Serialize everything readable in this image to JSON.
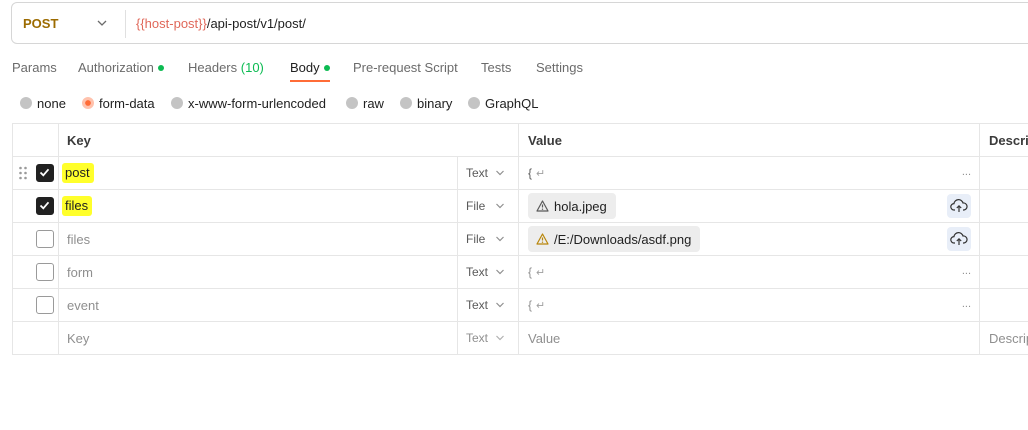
{
  "request": {
    "method": "POST",
    "url_variable": "{{host-post}}",
    "url_path": "/api-post/v1/post/"
  },
  "tabs": [
    {
      "label": "Params"
    },
    {
      "label": "Authorization",
      "indicator": true
    },
    {
      "label": "Headers",
      "count": "(10)"
    },
    {
      "label": "Body",
      "indicator": true,
      "active": true
    },
    {
      "label": "Pre-request Script"
    },
    {
      "label": "Tests"
    },
    {
      "label": "Settings"
    }
  ],
  "body_types": [
    {
      "label": "none",
      "selected": false
    },
    {
      "label": "form-data",
      "selected": true
    },
    {
      "label": "x-www-form-urlencoded",
      "selected": false
    },
    {
      "label": "raw",
      "selected": false
    },
    {
      "label": "binary",
      "selected": false
    },
    {
      "label": "GraphQL",
      "selected": false
    }
  ],
  "table": {
    "headers": {
      "key": "Key",
      "value": "Value",
      "description": "Descrip"
    },
    "rows": [
      {
        "checked": true,
        "key": "post",
        "type": "Text",
        "value": "{",
        "highlighted": true
      },
      {
        "checked": true,
        "key": "files",
        "type": "File",
        "file": "hola.jpeg",
        "highlighted": true
      },
      {
        "checked": false,
        "key": "files",
        "type": "File",
        "file": "/E:/Downloads/asdf.png"
      },
      {
        "checked": false,
        "key": "form",
        "type": "Text",
        "value": "{"
      },
      {
        "checked": false,
        "key": "event",
        "type": "Text",
        "value": "{"
      }
    ],
    "placeholder_row": {
      "key": "Key",
      "type": "Text",
      "value": "Value",
      "description": "Descrip"
    },
    "return_glyph": "↵",
    "ellipsis": "..."
  },
  "colors": {
    "accent": "#ff6c37",
    "method": "#9c6b00",
    "variable": "#e0685a",
    "indicator": "#0cbb52",
    "highlight": "#ffff2b"
  }
}
